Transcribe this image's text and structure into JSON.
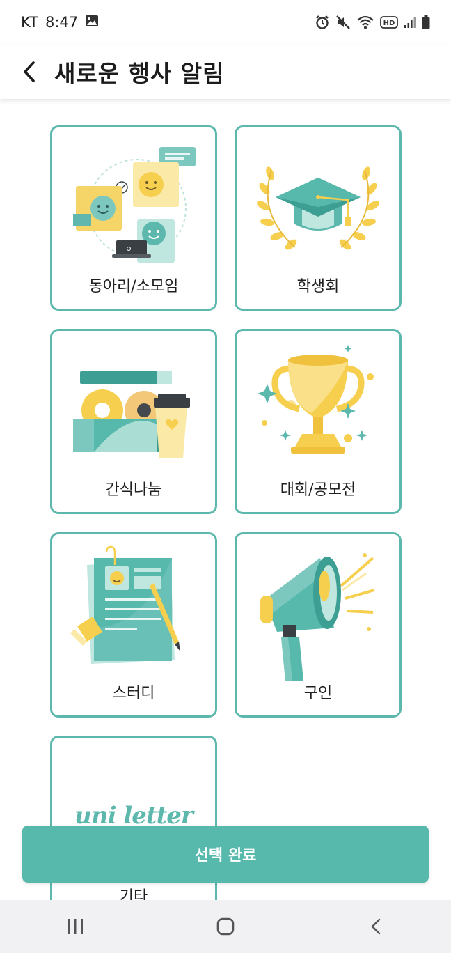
{
  "status_bar": {
    "carrier": "KT",
    "time": "8:47",
    "hd_label": "HD",
    "icons": [
      "gallery-icon",
      "alarm-icon",
      "mute-icon",
      "wifi-icon",
      "hd-icon",
      "signal-icon",
      "battery-icon"
    ]
  },
  "header": {
    "title": "새로운 행사 알림",
    "back_icon": "chevron-left-icon"
  },
  "categories": [
    {
      "label": "동아리/소모임",
      "icon": "club-chat-icon"
    },
    {
      "label": "학생회",
      "icon": "graduation-cap-icon"
    },
    {
      "label": "간식나눔",
      "icon": "snack-box-icon"
    },
    {
      "label": "대회/공모전",
      "icon": "trophy-icon"
    },
    {
      "label": "스터디",
      "icon": "study-papers-icon"
    },
    {
      "label": "구인",
      "icon": "megaphone-icon"
    },
    {
      "label": "기타",
      "brand": "uni letter",
      "icon": "brand-logo"
    }
  ],
  "confirm_button": {
    "label": "선택 완료"
  },
  "colors": {
    "accent": "#57b8ac",
    "card_border": "#5cb8ad",
    "yellow": "#f6cf4f",
    "teal_dark": "#3d9f93"
  },
  "nav_bar": {
    "icons": [
      "recents-icon",
      "home-icon",
      "back-icon"
    ]
  }
}
